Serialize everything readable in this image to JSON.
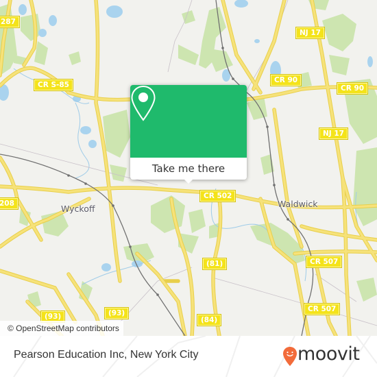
{
  "map": {
    "colors": {
      "background": "#f2f2ee",
      "road": "#f6e27a",
      "road_edge": "#e8cf4a",
      "water": "#a9d3ee",
      "park": "#cde5b0",
      "rail": "#707070",
      "boundary": "#c8c0c8"
    },
    "shields": [
      {
        "label": "287"
      },
      {
        "label": "CR S-85"
      },
      {
        "label": "NJ 17"
      },
      {
        "label": "CR 90"
      },
      {
        "label": "CR 90"
      },
      {
        "label": "NJ 17"
      },
      {
        "label": "CR 502"
      },
      {
        "label": "208"
      },
      {
        "label": "CR 507"
      },
      {
        "label": "(81)"
      },
      {
        "label": "CR 507"
      },
      {
        "label": "(84)"
      },
      {
        "label": "(93)"
      },
      {
        "label": "(93)"
      }
    ],
    "places": [
      {
        "name": "Wyckoff"
      },
      {
        "name": "Waldwick"
      }
    ],
    "attribution": "© OpenStreetMap contributors"
  },
  "popup": {
    "icon": "map-pin-icon",
    "color": "#1fba6c",
    "button_label": "Take me there"
  },
  "footer": {
    "title": "Pearson Education Inc, New York City",
    "logo_text": "moovit",
    "logo_icon": "moovit-pin-icon",
    "logo_color": "#f26b3a"
  }
}
